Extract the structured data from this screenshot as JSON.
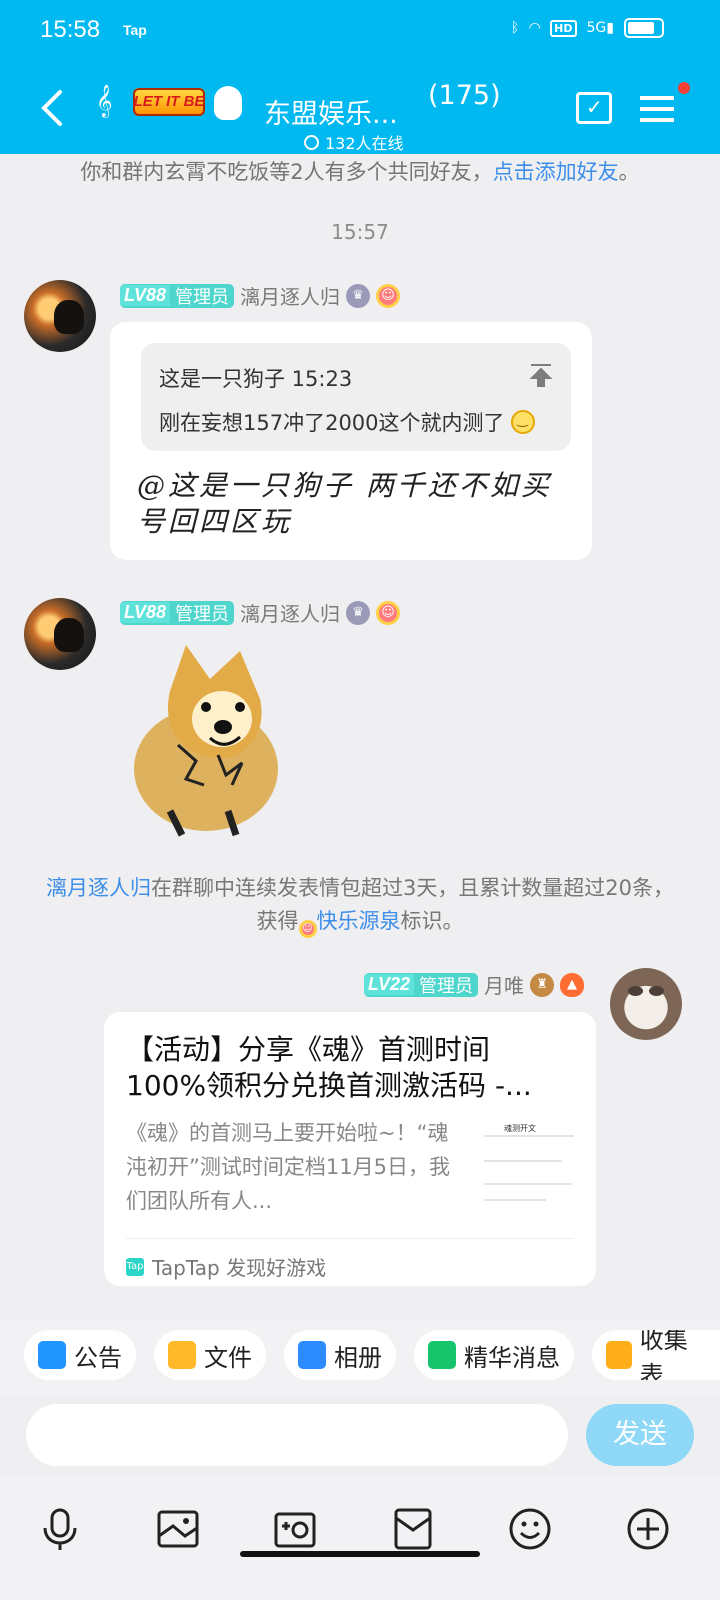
{
  "status": {
    "time": "15:58",
    "app": "Tap",
    "hd": "HD",
    "network": "5G"
  },
  "header": {
    "logo": "LET IT BE",
    "title": "东盟娱乐...",
    "count": "(175)",
    "online": "132人在线"
  },
  "tip": {
    "prefix": "你和群内玄霄不吃饭等2人有多个共同好友，",
    "link": "点击添加好友",
    "suffix": "。"
  },
  "timestamp": "15:57",
  "messages": [
    {
      "level": "LV88",
      "role": "管理员",
      "name": "漓月逐人归",
      "quote_head": "这是一只狗子 15:23",
      "quote_body": "刚在妄想157冲了2000这个就内测了",
      "text": "@这是一只狗子 两千还不如买号回四区玩"
    },
    {
      "level": "LV88",
      "role": "管理员",
      "name": "漓月逐人归"
    },
    {
      "level": "LV22",
      "role": "管理员",
      "name": "月唯",
      "card_title": "【活动】分享《魂》首测时间100%领积分兑换首测激活码 -...",
      "card_desc": "《魂》的首测马上要开始啦~！“魂沌初开”测试时间定档11月5日，我们团队所有人...",
      "card_source": "TapTap 发现好游戏",
      "thumb_title": "魂测开文"
    }
  ],
  "system": {
    "name": "漓月逐人归",
    "mid": "在群聊中连续发表情包超过3天，且累计数量超过20条，获得",
    "badge": "快乐源泉",
    "end": "标识。"
  },
  "tools": [
    {
      "label": "公告"
    },
    {
      "label": "文件"
    },
    {
      "label": "相册"
    },
    {
      "label": "精华消息"
    },
    {
      "label": "收集表"
    }
  ],
  "send": "发送",
  "colors": {
    "header": "#00b9f1",
    "link": "#3d8ee9",
    "level": "#4ed5cc",
    "send": "#8fd8f8"
  }
}
